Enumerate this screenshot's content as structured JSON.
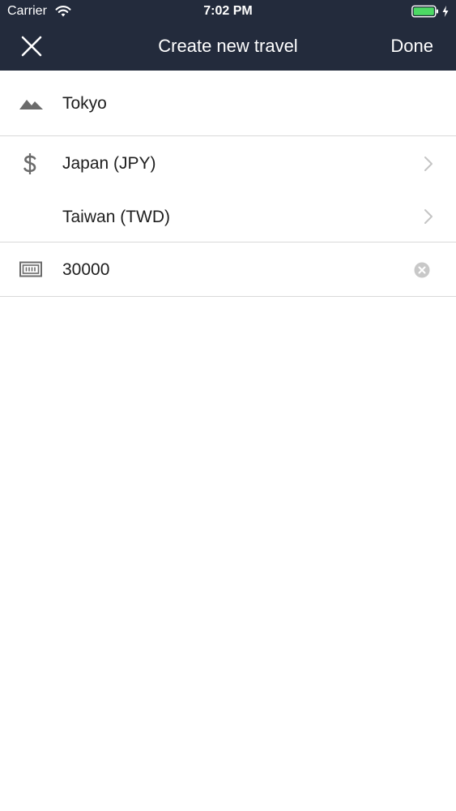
{
  "status": {
    "carrier": "Carrier",
    "time": "7:02 PM"
  },
  "nav": {
    "title": "Create new travel",
    "done_label": "Done"
  },
  "form": {
    "destination": "Tokyo",
    "currencies": [
      {
        "label": "Japan (JPY)"
      },
      {
        "label": "Taiwan (TWD)"
      }
    ],
    "budget": "30000"
  },
  "colors": {
    "header_bg": "#232b3c",
    "battery": "#4cd964"
  },
  "icons": [
    "wifi-icon",
    "battery-icon",
    "close-icon",
    "mountain-icon",
    "dollar-icon",
    "chevron-right-icon",
    "money-icon",
    "clear-icon"
  ]
}
